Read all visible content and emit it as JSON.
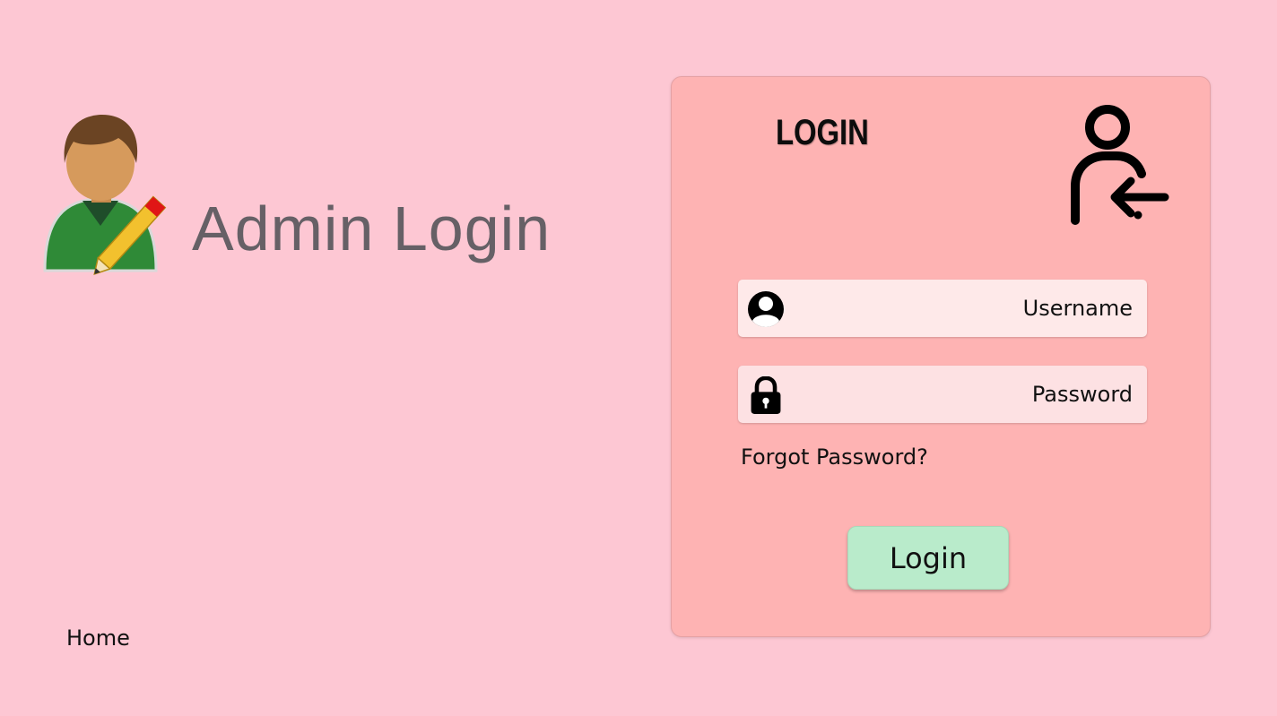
{
  "brand": {
    "title": "Admin Login",
    "avatar_icon": "admin-user-with-pencil-icon"
  },
  "nav": {
    "home_label": "Home"
  },
  "login_card": {
    "title": "LOGIN",
    "header_icon": "user-login-arrow-icon",
    "username": {
      "placeholder": "Username",
      "value": "",
      "icon": "user-circle-icon"
    },
    "password": {
      "placeholder": "Password",
      "value": "",
      "icon": "padlock-icon"
    },
    "forgot_label": "Forgot Password?",
    "submit_label": "Login"
  },
  "colors": {
    "page_background": "#fdc7d3",
    "card_background": "#feb3b3",
    "username_field": "#fee9e9",
    "password_field": "#fde1e3",
    "login_button": "#b9ebcb",
    "brand_text": "#666066"
  }
}
